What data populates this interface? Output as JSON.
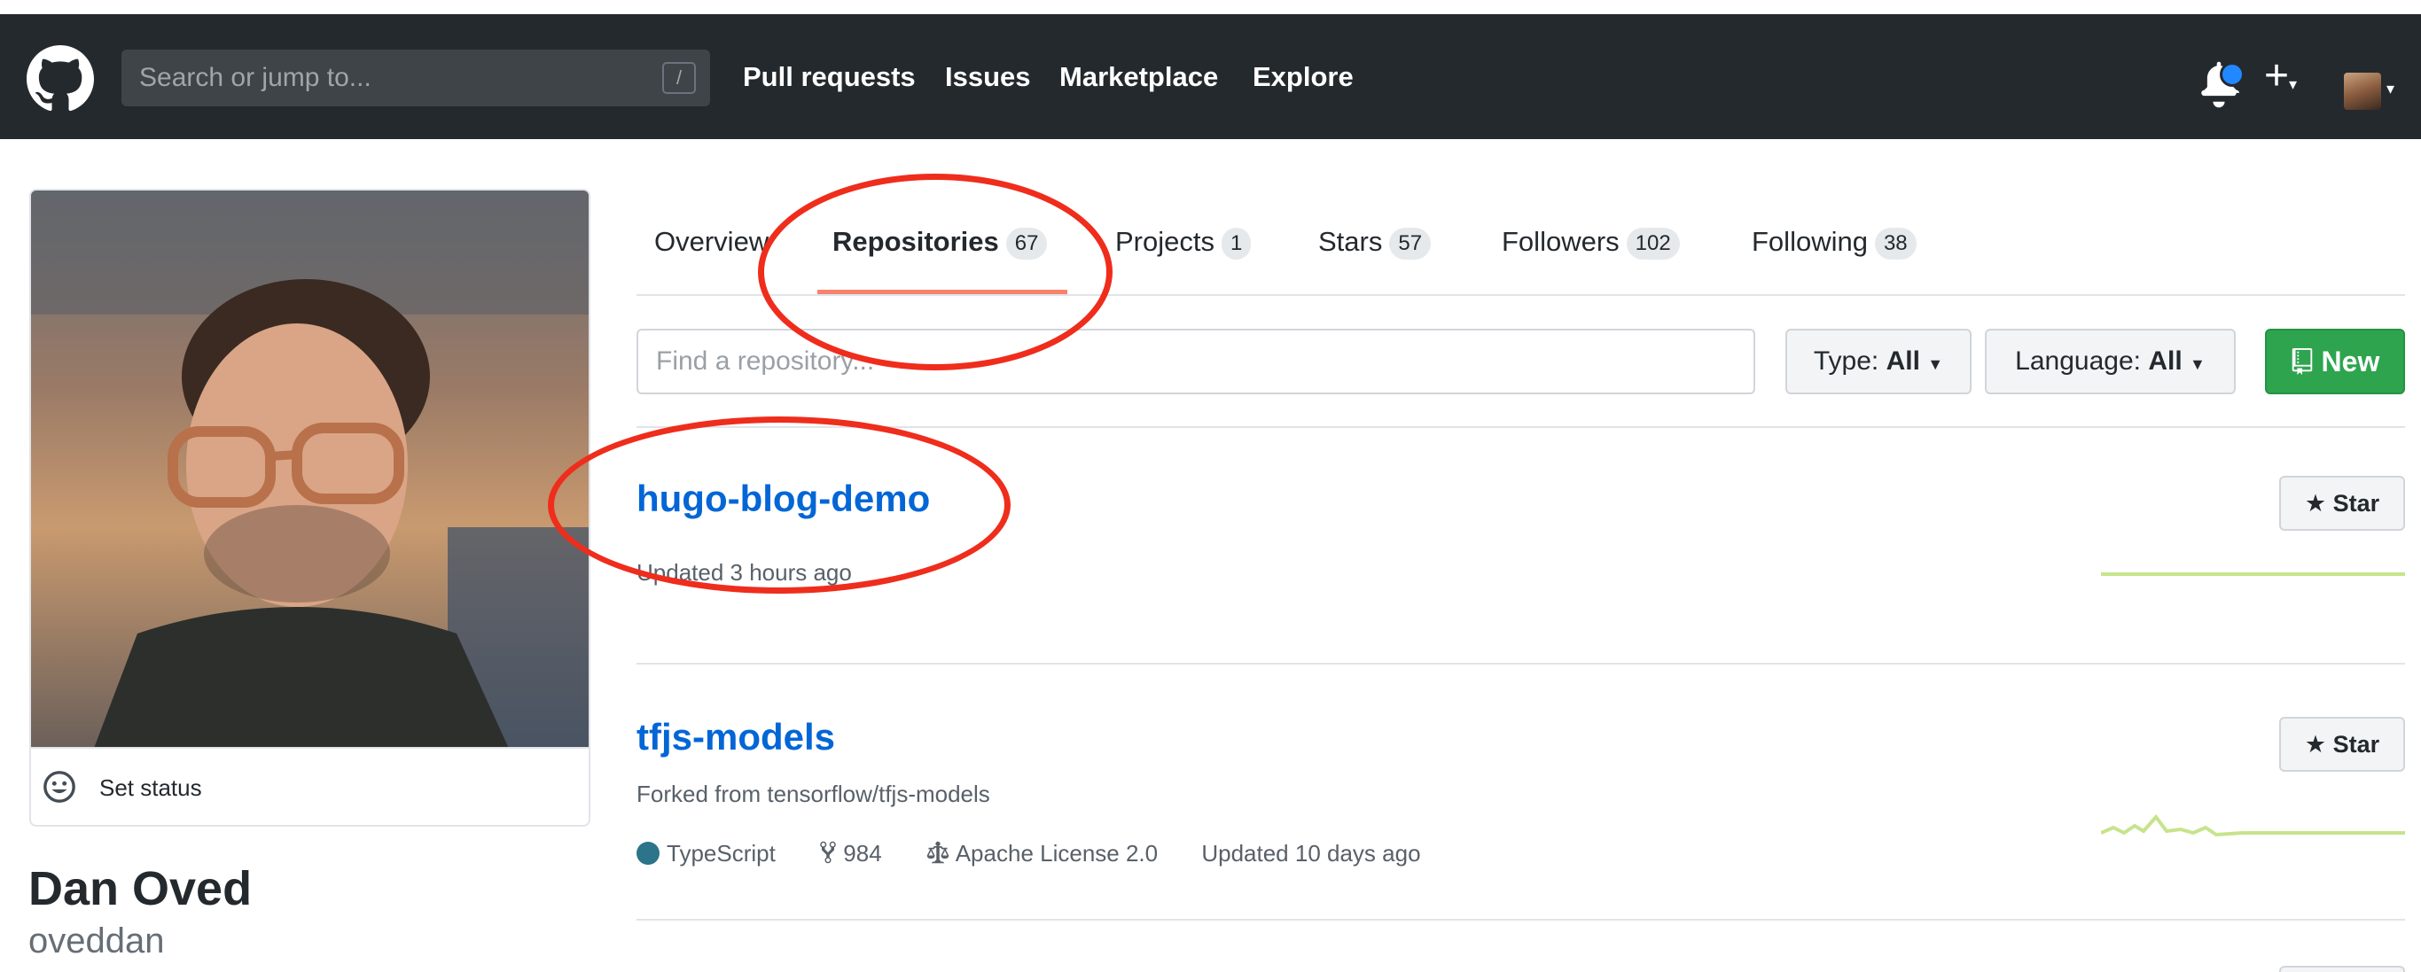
{
  "header": {
    "search_placeholder": "Search or jump to...",
    "search_shortcut": "/",
    "nav": [
      "Pull requests",
      "Issues",
      "Marketplace",
      "Explore"
    ],
    "plus_label": "+",
    "caret": "▾"
  },
  "profile": {
    "set_status": "Set status",
    "display_name": "Dan Oved",
    "username": "oveddan"
  },
  "tabs": [
    {
      "label": "Overview",
      "count": ""
    },
    {
      "label": "Repositories",
      "count": "67"
    },
    {
      "label": "Projects",
      "count": "1"
    },
    {
      "label": "Stars",
      "count": "57"
    },
    {
      "label": "Followers",
      "count": "102"
    },
    {
      "label": "Following",
      "count": "38"
    }
  ],
  "filters": {
    "find_placeholder": "Find a repository...",
    "type_label": "Type:",
    "type_value": "All",
    "language_label": "Language:",
    "language_value": "All",
    "new_label": "New"
  },
  "repos": [
    {
      "name": "hugo-blog-demo",
      "updated": "Updated 3 hours ago",
      "star_label": "Star"
    },
    {
      "name": "tfjs-models",
      "fork_info": "Forked from tensorflow/tfjs-models",
      "language": "TypeScript",
      "forks": "984",
      "license": "Apache License 2.0",
      "updated": "Updated 10 days ago",
      "star_label": "Star"
    }
  ],
  "colors": {
    "header_bg": "#24292e",
    "link": "#0366d6",
    "new_button": "#2ea44f",
    "tab_underline": "#f9826c",
    "annotation": "#ef2d1c",
    "typescript": "#2b7489",
    "sparkline": "#c6e48b"
  }
}
